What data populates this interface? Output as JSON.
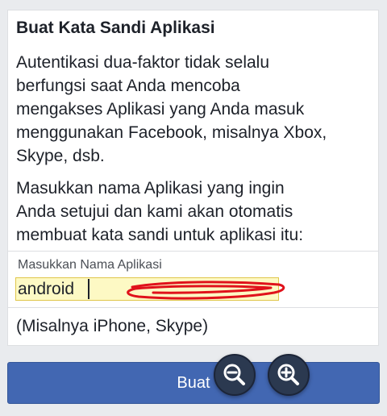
{
  "card": {
    "title": "Buat Kata Sandi Aplikasi",
    "paragraph1_lines": [
      "Autentikasi dua-faktor tidak selalu",
      "berfungsi saat Anda mencoba",
      "mengakses Aplikasi yang Anda masuk",
      "menggunakan Facebook, misalnya Xbox,",
      "Skype, dsb."
    ],
    "paragraph2_lines": [
      "Masukkan nama Aplikasi yang ingin",
      "Anda setujui dan kami akan otomatis",
      "membuat kata sandi untuk aplikasi itu:"
    ],
    "field_label": "Masukkan Nama Aplikasi",
    "field_value": "android",
    "hint": "(Misalnya iPhone, Skype)"
  },
  "buttons": {
    "submit_label": "Buat"
  },
  "zoom": {
    "out_icon": "zoom-out-icon",
    "in_icon": "zoom-in-icon"
  },
  "colors": {
    "page_background": "#e9ebee",
    "primary_button": "#4267b2",
    "field_highlight": "#fdf9c4",
    "annotation_scribble": "#e0121b",
    "zoom_button": "#2b3950"
  }
}
